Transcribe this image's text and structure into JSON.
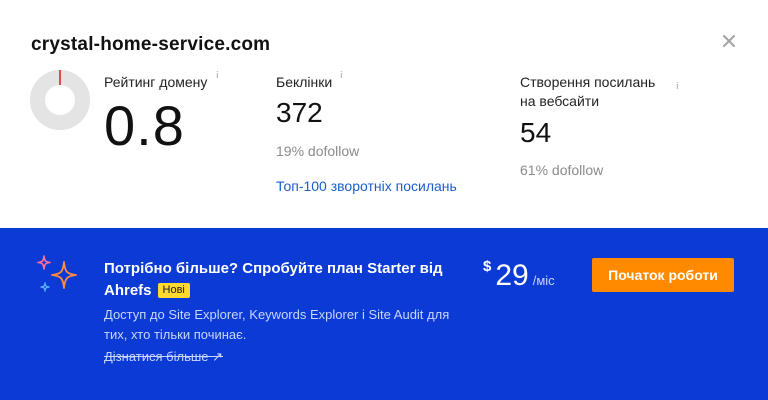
{
  "header": {
    "domain": "crystal-home-service.com",
    "close_icon": "close-icon"
  },
  "metrics": {
    "domain_rating": {
      "label": "Рейтинг домену",
      "info": "i",
      "value": "0.8",
      "donut_fraction": 0.008
    },
    "backlinks": {
      "label": "Беклінки",
      "info": "i",
      "value": "372",
      "sub": "19% dofollow",
      "link": "Топ-100 зворотніх посилань"
    },
    "linking": {
      "label_line1": "Створення посилань",
      "label_line2": "на вебсайти",
      "info": "i",
      "value": "54",
      "sub": "61% dofollow"
    }
  },
  "banner": {
    "title": "Потрібно більше? Спробуйте план Starter від Ahrefs",
    "badge": "Нові",
    "description": "Доступ до Site Explorer, Keywords Explorer і Site Audit для тих, хто тільки починає.",
    "learn_more": "Дізнатися більше ↗",
    "price_currency": "$",
    "price_amount": "29",
    "price_period": "/міс",
    "cta": "Початок роботи",
    "sparkles_icon": "sparkles-icon"
  },
  "colors": {
    "banner_bg": "#0b3bd4",
    "cta_bg": "#ff8a00",
    "badge_bg": "#ffd92e",
    "link": "#1a5fd0",
    "donut_track": "#e4e4e4",
    "donut_fill": "#e0261f"
  }
}
